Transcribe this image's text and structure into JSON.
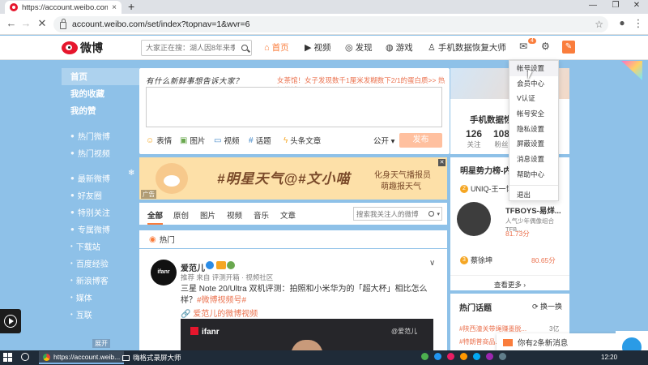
{
  "browser": {
    "tab_title": "https://account.weibo.com/se",
    "tab_close": "×",
    "new_tab": "+",
    "url": "account.weibo.com/set/index?topnav=1&wvr=6",
    "back": "←",
    "forward": "→",
    "reload": "✕",
    "min": "—",
    "max": "❐",
    "close": "✕",
    "menu": "⋮"
  },
  "header": {
    "logo_text": "微博",
    "search_placeholder": "大家正在搜：湖人因8年来季后...",
    "nav": {
      "home": "首页",
      "video": "视频",
      "discover": "发现",
      "game": "游戏",
      "user": "手机数据恢复大师"
    },
    "msg_badge": "4"
  },
  "leftnav": {
    "items": [
      {
        "label": "首页",
        "style": "bold hl"
      },
      {
        "label": "我的收藏",
        "style": "bold"
      },
      {
        "label": "我的赞",
        "style": "bold"
      },
      {
        "label": "热门微博",
        "style": ""
      },
      {
        "label": "热门视频",
        "style": ""
      },
      {
        "label": "最新微博",
        "style": ""
      },
      {
        "label": "好友圈",
        "style": ""
      },
      {
        "label": "特别关注",
        "style": ""
      },
      {
        "label": "专属微博",
        "style": ""
      },
      {
        "label": "下载站",
        "style": ""
      },
      {
        "label": "百度经验",
        "style": ""
      },
      {
        "label": "新浪博客",
        "style": ""
      },
      {
        "label": "媒体",
        "style": ""
      },
      {
        "label": "互联",
        "style": ""
      }
    ],
    "unfold": "展开"
  },
  "compose": {
    "hint": "有什么新鲜事想告诉大家？",
    "hot_topic": "女茶馆！女子发现数千1厘米发糊数下2/1的蛋白质>>  热门微博",
    "tools": {
      "emoji": "表情",
      "image": "图片",
      "video": "视频",
      "topic": "话题",
      "headline": "头条文章"
    },
    "public": "公开 ▾",
    "send": "发布"
  },
  "banner": {
    "title": "#明星天气@#文小喵",
    "sub1": "化身天气播报员",
    "sub2": "萌趣报天气",
    "ad": "广告",
    "close": "✕"
  },
  "feed": {
    "tabs": [
      "全部",
      "原创",
      "图片",
      "视频",
      "音乐",
      "文章"
    ],
    "search_placeholder": "搜索我关注人的微博",
    "hot_label": "热门"
  },
  "post": {
    "avatar_text": "ifanr",
    "username": "爱范儿",
    "meta": "推荐 来自 评测开箱 · 视频社区",
    "text": "三星 Note 20/Ultra 双机评测：拍照和小米华为的「超大杯」相比怎么样？",
    "tag": "#微博视频号#",
    "link": "🔗 爱范儿的微博视频",
    "video_logo": "ifanr",
    "video_watermark": "@爱范儿"
  },
  "profile": {
    "name": "手机数据恢",
    "stats": [
      {
        "n": "126",
        "l": "关注"
      },
      {
        "n": "108",
        "l": "粉丝"
      }
    ]
  },
  "stars": {
    "head": "明星势力榜-内地",
    "r1": "UNIQ-王一博",
    "r1_rank": "2",
    "tf_name": "TFBOYS-易烊...",
    "tf_sub": "人气少年偶像组合TFB...",
    "tf_val": "81.73分",
    "r3": "蔡徐坤",
    "r3_rank": "3",
    "r3_val": "80.65分",
    "more": "查看更多 ›"
  },
  "hot_topics": {
    "head": "热门话题",
    "switch": "换一换",
    "items": [
      {
        "t": "#陕西潼关带绳赚墨脱...",
        "v": "3亿"
      },
      {
        "t": "#特朗普商品...",
        "v": ""
      }
    ]
  },
  "dropdown": {
    "items": [
      "帐号设置",
      "会员中心",
      "V认证",
      "帐号安全",
      "隐私设置",
      "屏蔽设置",
      "消息设置",
      "帮助中心"
    ],
    "logout": "退出"
  },
  "toast": {
    "text": "你有2条新消息"
  },
  "taskbar": {
    "chrome_label": "https://account.weib...",
    "recorder_label": "嗨格式录屏大师",
    "clock": "12:20"
  }
}
